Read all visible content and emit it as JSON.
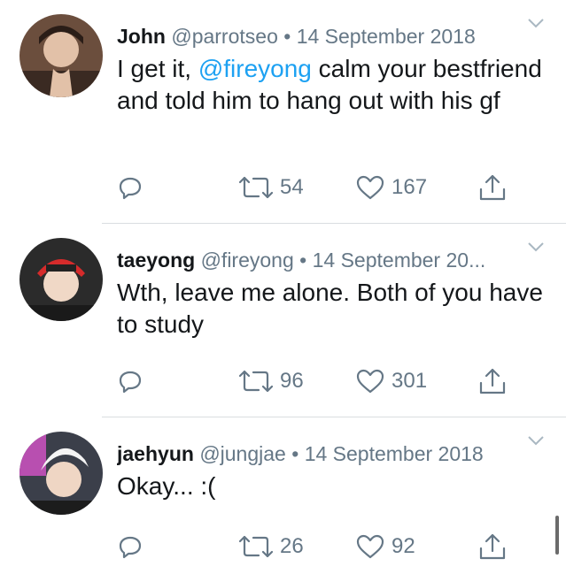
{
  "tweets": [
    {
      "name": "John",
      "handle": "@parrotseo",
      "separator": "•",
      "date": "14 September 2018",
      "text_before": "I get it, ",
      "mention": "@fireyong",
      "text_after": " calm your bestfriend and told him to hang out with his gf",
      "retweets": "54",
      "likes": "167"
    },
    {
      "name": "taeyong",
      "handle": "@fireyong",
      "separator": "•",
      "date": "14 September 20...",
      "text_before": "Wth, leave me alone. Both of you have to study",
      "mention": "",
      "text_after": "",
      "retweets": "96",
      "likes": "301"
    },
    {
      "name": "jaehyun",
      "handle": "@jungjae",
      "separator": "•",
      "date": "14 September 2018",
      "text_before": "Okay... :(",
      "mention": "",
      "text_after": "",
      "retweets": "26",
      "likes": "92"
    }
  ],
  "colors": {
    "mention": "#1da1f2",
    "meta": "#657786",
    "text": "#14171a"
  },
  "icons": [
    "reply-icon",
    "retweet-icon",
    "like-icon",
    "share-icon",
    "chevron-down-icon"
  ]
}
